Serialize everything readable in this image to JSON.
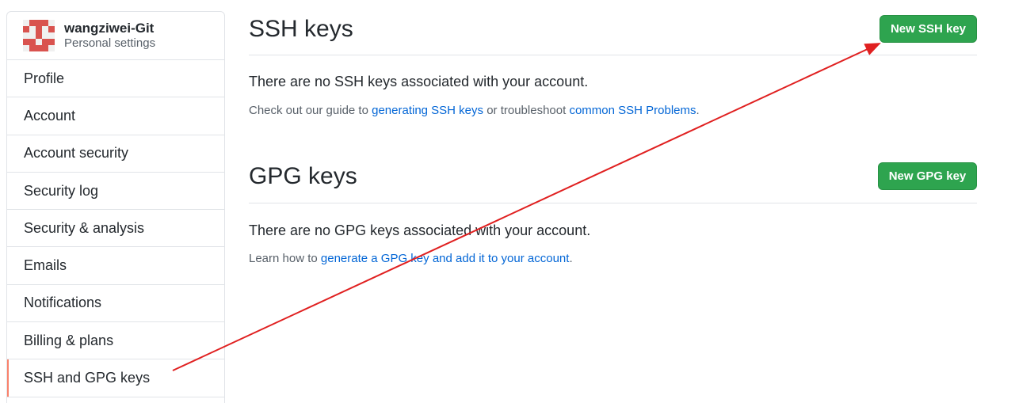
{
  "sidebar": {
    "username": "wangziwei-Git",
    "subtitle": "Personal settings",
    "items": [
      {
        "label": "Profile"
      },
      {
        "label": "Account"
      },
      {
        "label": "Account security"
      },
      {
        "label": "Security log"
      },
      {
        "label": "Security & analysis"
      },
      {
        "label": "Emails"
      },
      {
        "label": "Notifications"
      },
      {
        "label": "Billing & plans"
      },
      {
        "label": "SSH and GPG keys",
        "selected": true
      }
    ]
  },
  "ssh": {
    "title": "SSH keys",
    "button": "New SSH key",
    "empty_message": "There are no SSH keys associated with your account.",
    "guide_prefix": "Check out our guide to ",
    "guide_link1": "generating SSH keys",
    "guide_middle": " or troubleshoot ",
    "guide_link2": "common SSH Problems",
    "guide_suffix": "."
  },
  "gpg": {
    "title": "GPG keys",
    "button": "New GPG key",
    "empty_message": "There are no GPG keys associated with your account.",
    "learn_prefix": "Learn how to ",
    "learn_link": "generate a GPG key and add it to your account",
    "learn_suffix": "."
  },
  "colors": {
    "button_green": "#2ea44f",
    "link_blue": "#0366d6",
    "selected_marker": "#f9826c",
    "annotation_arrow": "#e02020"
  }
}
